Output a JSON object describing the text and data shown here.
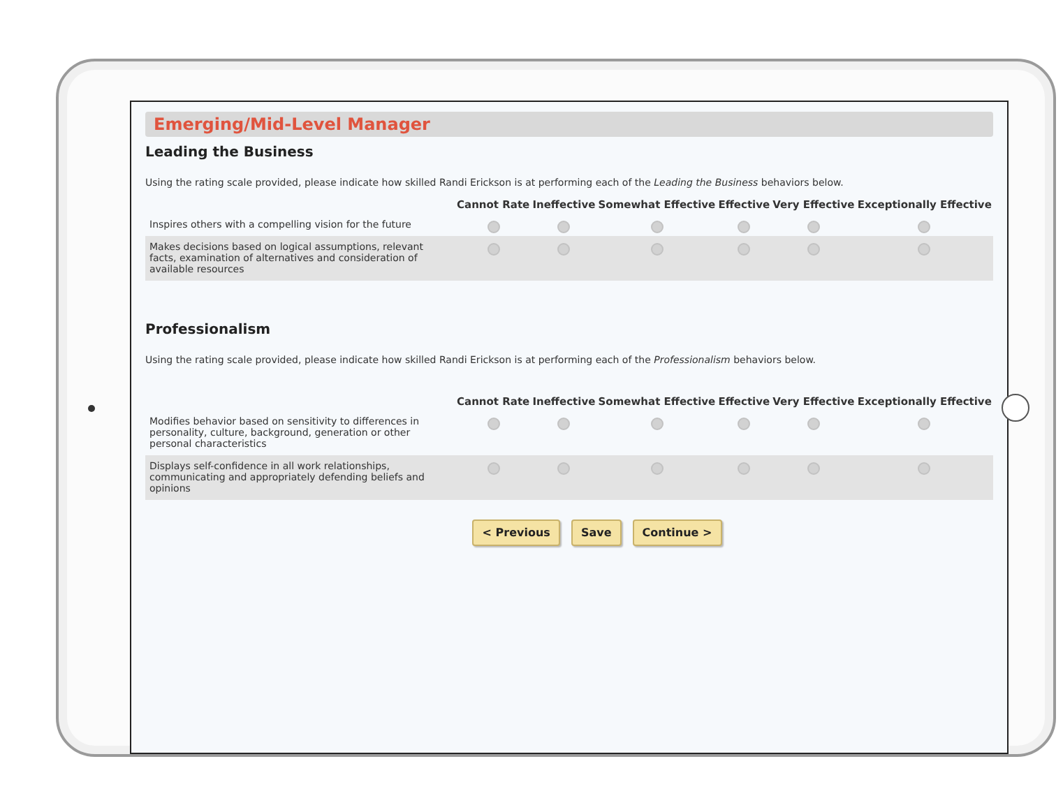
{
  "page": {
    "title": "Emerging/Mid-Level Manager"
  },
  "sections": [
    {
      "heading": "Leading the Business",
      "instructions": "Using the rating scale provided, please indicate how skilled Randi Erickson is at performing each of the *Leading the Business* behaviors below.",
      "columns": [
        "Cannot Rate",
        "Ineffective",
        "Somewhat Effective",
        "Effective",
        "Very Effective",
        "Exceptionally Effective"
      ],
      "rows": [
        {
          "behavior": "Inspires others with a compelling vision for the future",
          "options": [
            {
              "selected": false
            },
            {
              "selected": false
            },
            {
              "selected": false
            },
            {
              "selected": false
            },
            {
              "selected": false
            },
            {
              "selected": false
            }
          ]
        },
        {
          "behavior": "Makes decisions based on logical assumptions, relevant facts, examination of alternatives and consideration of available resources",
          "options": [
            {
              "selected": false
            },
            {
              "selected": false
            },
            {
              "selected": false
            },
            {
              "selected": false
            },
            {
              "selected": false
            },
            {
              "selected": false
            }
          ]
        }
      ]
    },
    {
      "heading": "Professionalism",
      "instructions": "Using the rating scale provided, please indicate how skilled Randi Erickson is at performing each of the *Professionalism* behaviors below.",
      "columns": [
        "Cannot Rate",
        "Ineffective",
        "Somewhat Effective",
        "Effective",
        "Very Effective",
        "Exceptionally Effective"
      ],
      "rows": [
        {
          "behavior": "Modifies behavior based on sensitivity to differences in personality, culture, background, generation or other personal characteristics",
          "options": [
            {
              "selected": false
            },
            {
              "selected": false
            },
            {
              "selected": false
            },
            {
              "selected": false
            },
            {
              "selected": false
            },
            {
              "selected": false
            }
          ]
        },
        {
          "behavior": "Displays self-confidence in all work relationships, communicating and appropriately defending beliefs and opinions",
          "options": [
            {
              "selected": false
            },
            {
              "selected": false
            },
            {
              "selected": false
            },
            {
              "selected": false
            },
            {
              "selected": false
            },
            {
              "selected": false
            }
          ]
        }
      ]
    }
  ],
  "buttons": [
    "< Previous",
    "Save",
    "Continue >"
  ]
}
